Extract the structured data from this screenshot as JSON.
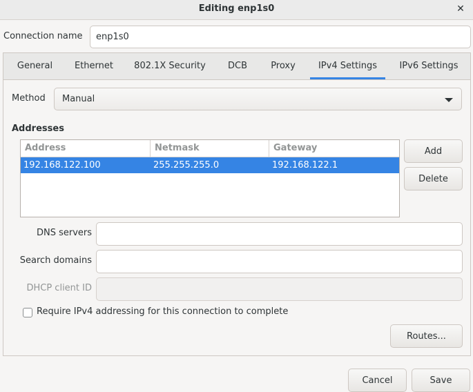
{
  "window": {
    "title": "Editing enp1s0",
    "close_glyph": "✕"
  },
  "connection": {
    "label": "Connection name",
    "value": "enp1s0"
  },
  "tabs": [
    {
      "label": "General"
    },
    {
      "label": "Ethernet"
    },
    {
      "label": "802.1X Security"
    },
    {
      "label": "DCB"
    },
    {
      "label": "Proxy"
    },
    {
      "label": "IPv4 Settings",
      "active": true
    },
    {
      "label": "IPv6 Settings"
    }
  ],
  "method": {
    "label": "Method",
    "value": "Manual"
  },
  "addresses": {
    "title": "Addresses",
    "columns": [
      "Address",
      "Netmask",
      "Gateway"
    ],
    "rows": [
      {
        "address": "192.168.122.100",
        "netmask": "255.255.255.0",
        "gateway": "192.168.122.1",
        "selected": true
      }
    ],
    "add_label": "Add",
    "delete_label": "Delete"
  },
  "dns": {
    "label": "DNS servers",
    "value": ""
  },
  "search_domains": {
    "label": "Search domains",
    "value": ""
  },
  "dhcp_client_id": {
    "label": "DHCP client ID",
    "value": "",
    "disabled": true
  },
  "require_ipv4": {
    "label": "Require IPv4 addressing for this connection to complete",
    "checked": false
  },
  "routes_label": "Routes...",
  "footer": {
    "cancel_label": "Cancel",
    "save_label": "Save"
  },
  "colors": {
    "accent": "#3584e4",
    "background": "#f6f5f4"
  }
}
